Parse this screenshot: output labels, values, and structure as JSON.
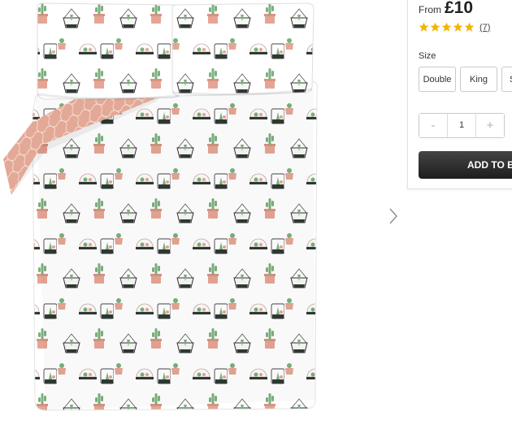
{
  "product": {
    "image_alt_icon": "duvet-set-photo",
    "price_prefix": "From",
    "price": "£10",
    "rating": 5,
    "rating_max": 5,
    "review_count": "(7)",
    "size_label": "Size",
    "sizes": [
      "Double",
      "King",
      "Si"
    ],
    "quantity": "1",
    "qty_minus": "-",
    "qty_plus": "+",
    "add_button_label": "ADD TO B"
  },
  "colors": {
    "star": "#f4b400",
    "button": "#2a2a2a",
    "pattern_pink": "#e6a594",
    "pattern_green": "#7cb07d",
    "pattern_dark": "#2f3a34"
  },
  "icons": {
    "next": "chevron-right-icon",
    "star": "star-icon"
  }
}
